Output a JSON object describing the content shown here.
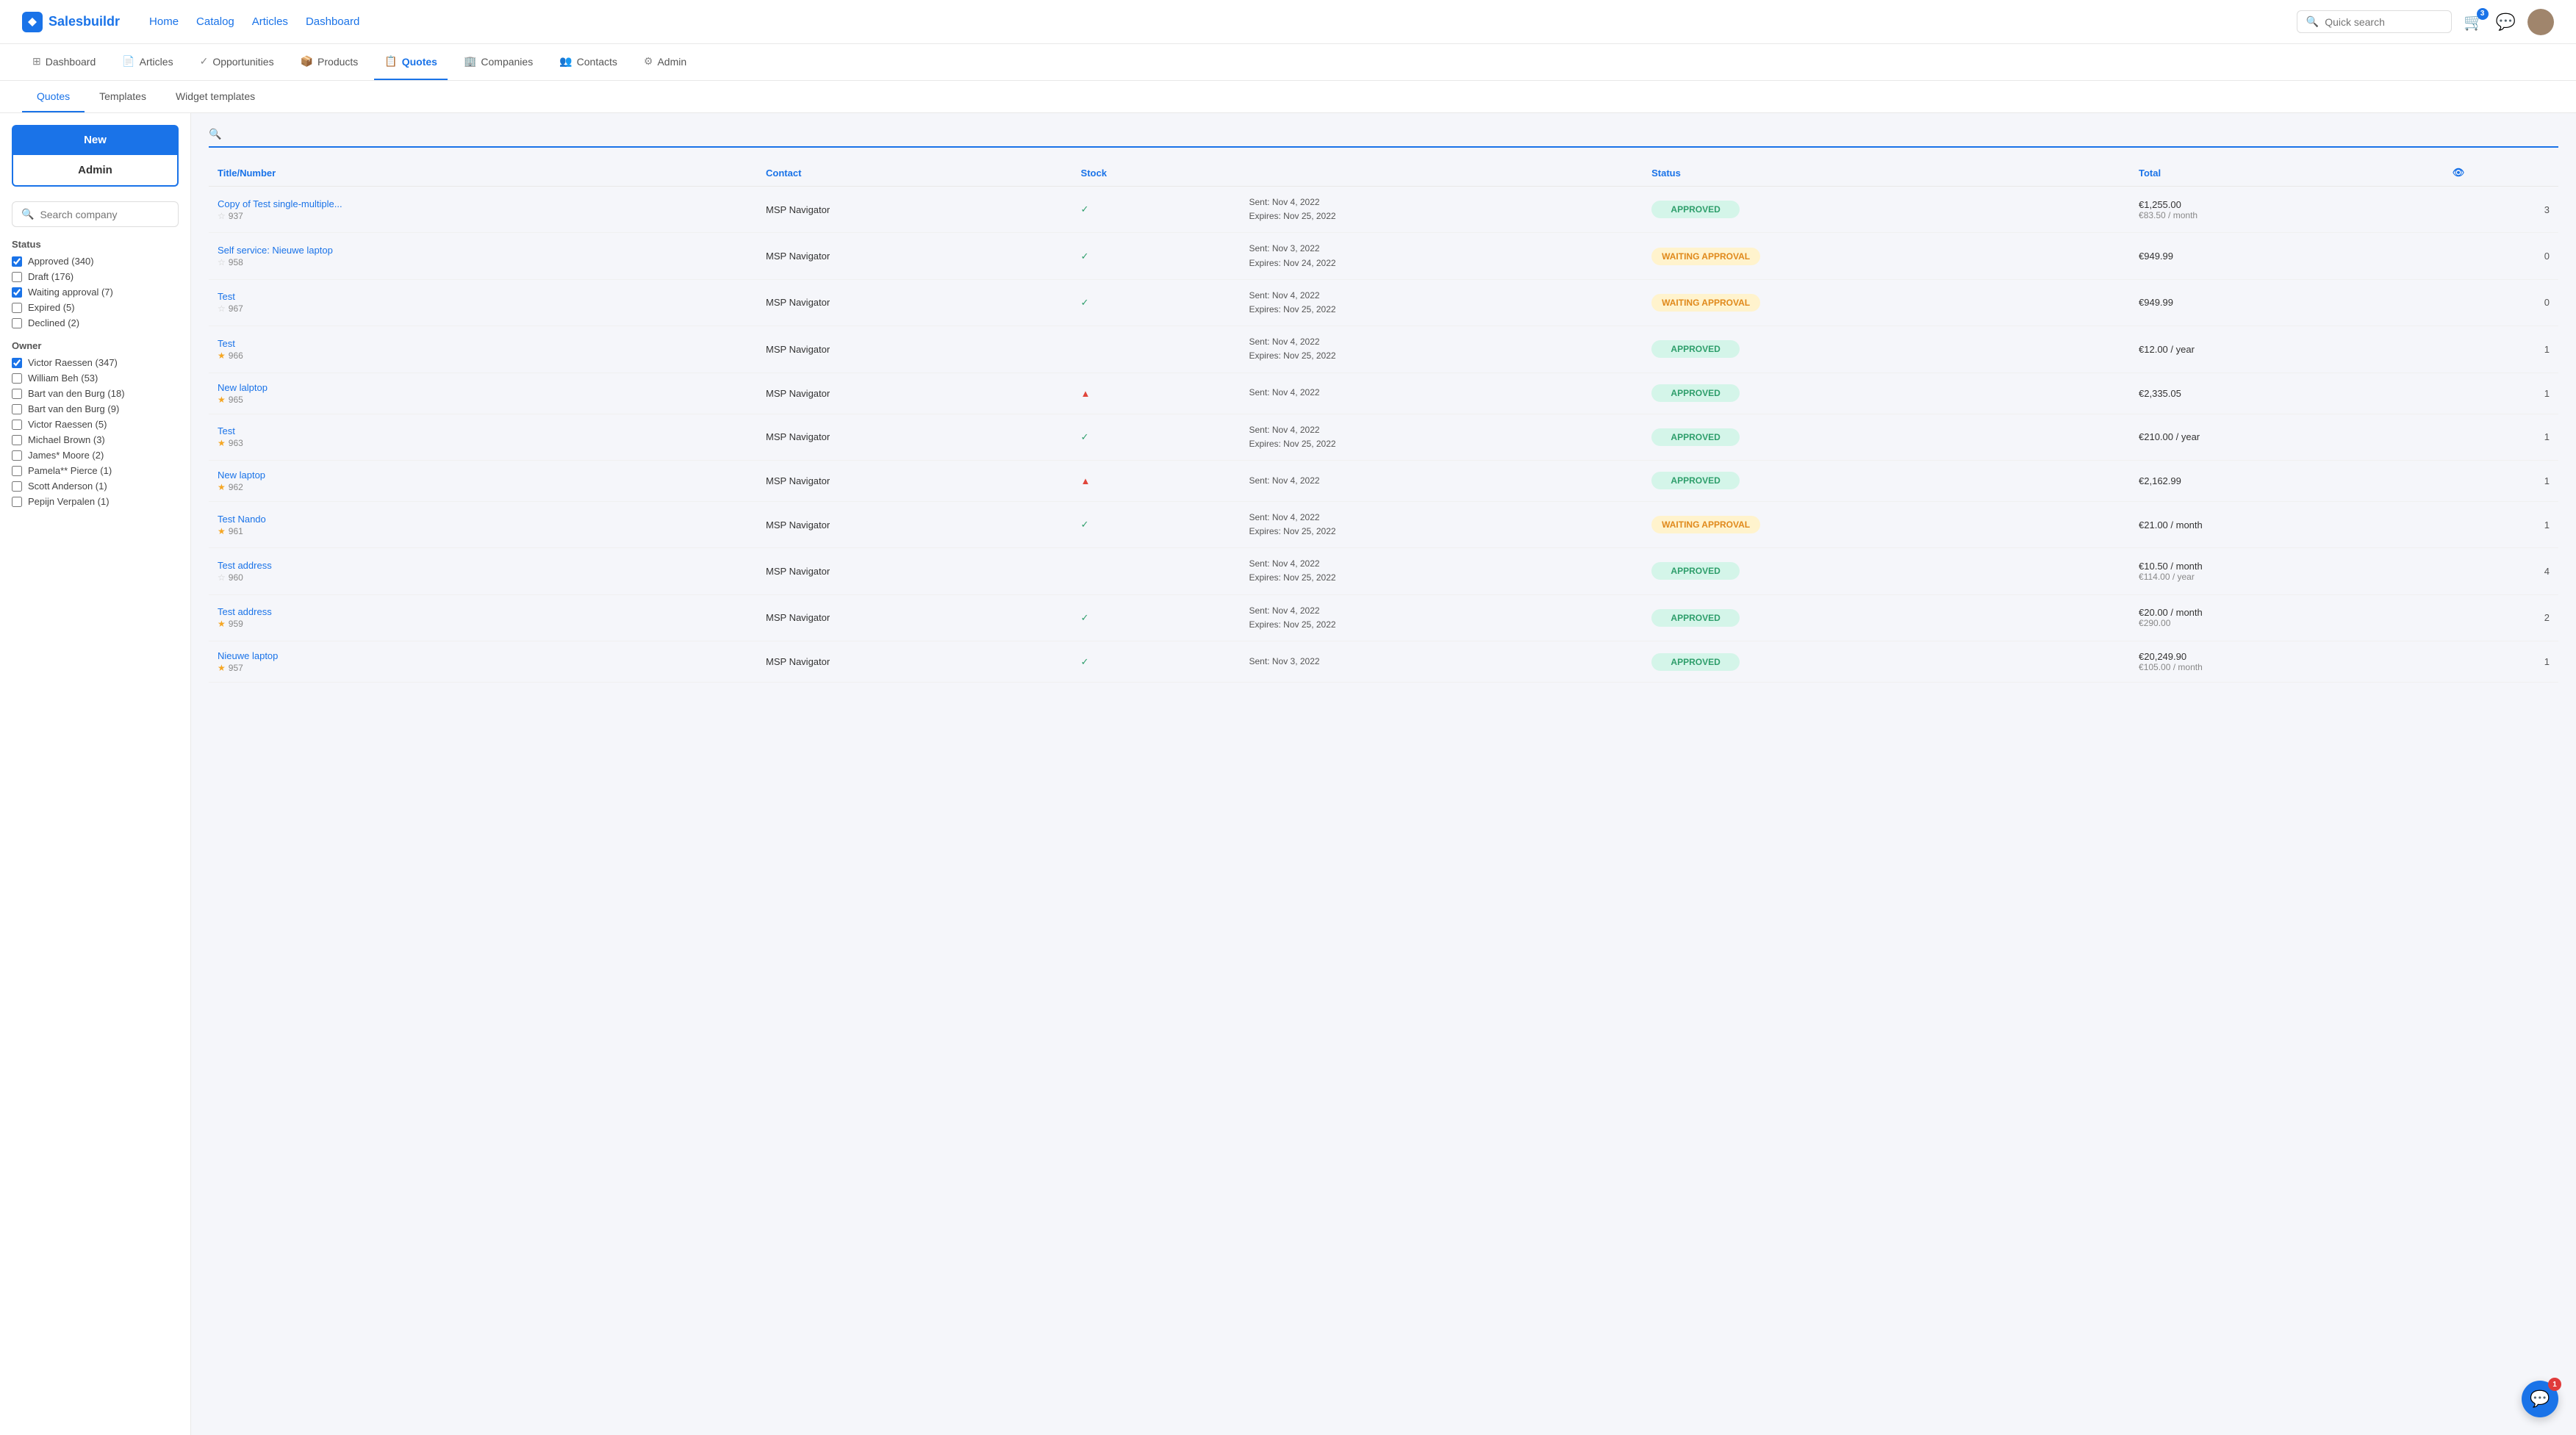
{
  "brand": {
    "name": "Salesbuildr"
  },
  "topNav": {
    "links": [
      {
        "label": "Home",
        "href": "#",
        "active": false
      },
      {
        "label": "Catalog",
        "href": "#",
        "active": false
      },
      {
        "label": "Articles",
        "href": "#",
        "active": false
      },
      {
        "label": "Dashboard",
        "href": "#",
        "active": false
      }
    ],
    "searchPlaceholder": "Quick search",
    "cartCount": "3"
  },
  "secondNav": {
    "items": [
      {
        "label": "Dashboard",
        "icon": "⊞",
        "active": false
      },
      {
        "label": "Articles",
        "icon": "📄",
        "active": false
      },
      {
        "label": "Opportunities",
        "icon": "✓",
        "active": false
      },
      {
        "label": "Products",
        "icon": "📦",
        "active": false
      },
      {
        "label": "Quotes",
        "icon": "📋",
        "active": true
      },
      {
        "label": "Companies",
        "icon": "🏢",
        "active": false
      },
      {
        "label": "Contacts",
        "icon": "👥",
        "active": false
      },
      {
        "label": "Admin",
        "icon": "⚙",
        "active": false
      }
    ]
  },
  "tabs": [
    {
      "label": "Quotes",
      "active": true
    },
    {
      "label": "Templates",
      "active": false
    },
    {
      "label": "Widget templates",
      "active": false
    }
  ],
  "sidebar": {
    "newLabel": "New",
    "adminLabel": "Admin",
    "searchPlaceholder": "Search company",
    "statusTitle": "Status",
    "statusItems": [
      {
        "label": "Approved (340)",
        "checked": true
      },
      {
        "label": "Draft (176)",
        "checked": false
      },
      {
        "label": "Waiting approval (7)",
        "checked": true
      },
      {
        "label": "Expired (5)",
        "checked": false
      },
      {
        "label": "Declined (2)",
        "checked": false
      }
    ],
    "ownerTitle": "Owner",
    "ownerItems": [
      {
        "label": "Victor Raessen (347)",
        "checked": true
      },
      {
        "label": "William Beh (53)",
        "checked": false
      },
      {
        "label": "Bart van den Burg (18)",
        "checked": false
      },
      {
        "label": "Bart van den Burg (9)",
        "checked": false
      },
      {
        "label": "Victor Raessen (5)",
        "checked": false
      },
      {
        "label": "Michael Brown (3)",
        "checked": false
      },
      {
        "label": "James* Moore (2)",
        "checked": false
      },
      {
        "label": "Pamela** Pierce (1)",
        "checked": false
      },
      {
        "label": "Scott Anderson (1)",
        "checked": false
      },
      {
        "label": "Pepijn Verpalen (1)",
        "checked": false
      }
    ]
  },
  "table": {
    "columns": [
      {
        "label": "Title/Number"
      },
      {
        "label": "Contact"
      },
      {
        "label": "Stock"
      },
      {
        "label": "Status"
      },
      {
        "label": "Total"
      },
      {
        "label": "👁"
      }
    ],
    "rows": [
      {
        "title": "Copy of Test single-multiple...",
        "number": "937",
        "starred": false,
        "contact": "MSP Navigator",
        "stock": "check",
        "sentDate": "Sent: Nov 4, 2022",
        "expiresDate": "Expires: Nov 25, 2022",
        "status": "APPROVED",
        "statusType": "approved",
        "price": "€1,255.00",
        "priceSub": "€83.50 / month",
        "count": "3"
      },
      {
        "title": "Self service: Nieuwe laptop",
        "number": "958",
        "starred": false,
        "contact": "MSP Navigator",
        "stock": "check",
        "sentDate": "Sent: Nov 3, 2022",
        "expiresDate": "Expires: Nov 24, 2022",
        "status": "WAITING APPROVAL",
        "statusType": "waiting",
        "price": "€949.99",
        "priceSub": "",
        "count": "0"
      },
      {
        "title": "Test",
        "number": "967",
        "starred": false,
        "contact": "MSP Navigator",
        "stock": "check",
        "sentDate": "Sent: Nov 4, 2022",
        "expiresDate": "Expires: Nov 25, 2022",
        "status": "WAITING APPROVAL",
        "statusType": "waiting",
        "price": "€949.99",
        "priceSub": "",
        "count": "0"
      },
      {
        "title": "Test",
        "number": "966",
        "starred": true,
        "contact": "MSP Navigator",
        "stock": "none",
        "sentDate": "Sent: Nov 4, 2022",
        "expiresDate": "Expires: Nov 25, 2022",
        "status": "APPROVED",
        "statusType": "approved",
        "price": "€12.00 / year",
        "priceSub": "",
        "count": "1"
      },
      {
        "title": "New lalptop",
        "number": "965",
        "starred": true,
        "contact": "MSP Navigator",
        "stock": "warn",
        "sentDate": "Sent: Nov 4, 2022",
        "expiresDate": "",
        "status": "APPROVED",
        "statusType": "approved",
        "price": "€2,335.05",
        "priceSub": "",
        "count": "1"
      },
      {
        "title": "Test",
        "number": "963",
        "starred": true,
        "contact": "MSP Navigator",
        "stock": "check",
        "sentDate": "Sent: Nov 4, 2022",
        "expiresDate": "Expires: Nov 25, 2022",
        "status": "APPROVED",
        "statusType": "approved",
        "price": "€210.00 / year",
        "priceSub": "",
        "count": "1"
      },
      {
        "title": "New laptop",
        "number": "962",
        "starred": true,
        "contact": "MSP Navigator",
        "stock": "warn",
        "sentDate": "Sent: Nov 4, 2022",
        "expiresDate": "",
        "status": "APPROVED",
        "statusType": "approved",
        "price": "€2,162.99",
        "priceSub": "",
        "count": "1"
      },
      {
        "title": "Test Nando",
        "number": "961",
        "starred": true,
        "contact": "MSP Navigator",
        "stock": "check",
        "sentDate": "Sent: Nov 4, 2022",
        "expiresDate": "Expires: Nov 25, 2022",
        "status": "WAITING APPROVAL",
        "statusType": "waiting",
        "price": "€21.00 / month",
        "priceSub": "",
        "count": "1"
      },
      {
        "title": "Test address",
        "number": "960",
        "starred": false,
        "contact": "MSP Navigator",
        "stock": "none",
        "sentDate": "Sent: Nov 4, 2022",
        "expiresDate": "Expires: Nov 25, 2022",
        "status": "APPROVED",
        "statusType": "approved",
        "price": "€10.50 / month",
        "priceSub": "€114.00 / year",
        "count": "4"
      },
      {
        "title": "Test address",
        "number": "959",
        "starred": true,
        "contact": "MSP Navigator",
        "stock": "check",
        "sentDate": "Sent: Nov 4, 2022",
        "expiresDate": "Expires: Nov 25, 2022",
        "status": "APPROVED",
        "statusType": "approved",
        "price": "€20.00 / month",
        "priceSub": "€290.00",
        "count": "2"
      },
      {
        "title": "Nieuwe laptop",
        "number": "957",
        "starred": true,
        "contact": "MSP Navigator",
        "stock": "check",
        "sentDate": "Sent: Nov 3, 2022",
        "expiresDate": "",
        "status": "APPROVED",
        "statusType": "approved",
        "price": "€20,249.90",
        "priceSub": "€105.00 / month",
        "count": "1"
      }
    ]
  },
  "chat": {
    "badgeCount": "1"
  }
}
